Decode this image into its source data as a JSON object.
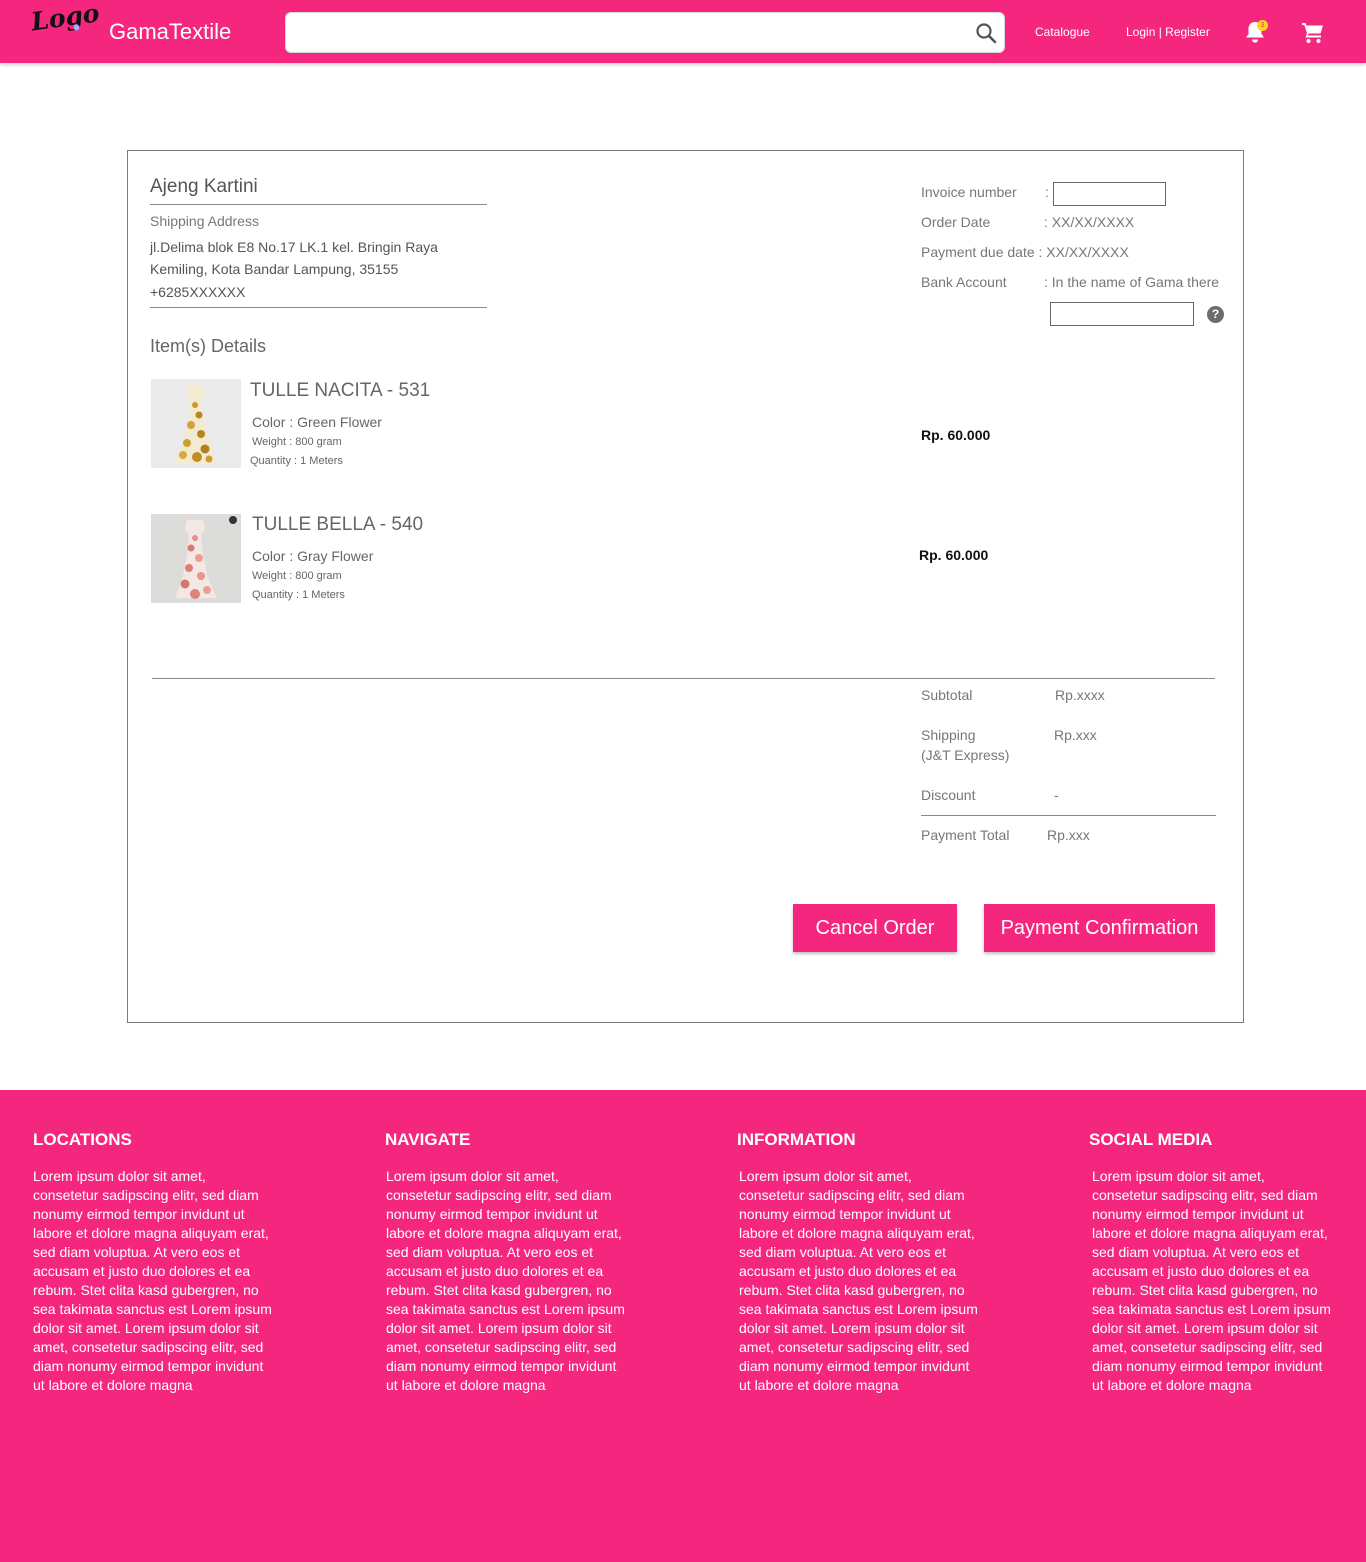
{
  "header": {
    "logo_text": "Logo",
    "brand": "GamaTextile",
    "search": {
      "value": "",
      "placeholder": ""
    },
    "catalogue": "Catalogue",
    "login_register": "Login | Register",
    "notification_count": "3"
  },
  "customer": {
    "name": "Ajeng Kartini",
    "shipping_label": "Shipping Address",
    "address_line1": "jl.Delima blok E8 No.17 LK.1 kel. Bringin Raya",
    "address_line2": "Kemiling, Kota Bandar Lampung, 35155",
    "phone": "+6285XXXXXX"
  },
  "invoice": {
    "invoice_number_label": "Invoice number",
    "invoice_number_value": "",
    "order_date_label": "Order Date",
    "order_date_value": ": XX/XX/XXXX",
    "payment_due_label": "Payment due date : XX/XX/XXXX",
    "bank_account_label": "Bank Account",
    "bank_account_value": ": In the name of Gama there",
    "bank_account_input": "",
    "colon": ":",
    "help": "?"
  },
  "items_title": "Item(s) Details",
  "items": [
    {
      "name": "TULLE NACITA - 531",
      "color": "Color : Green Flower",
      "weight": "Weight : 800 gram",
      "quantity": "Quantity : 1 Meters",
      "price": "Rp. 60.000"
    },
    {
      "name": "TULLE BELLA - 540",
      "color": "Color : Gray Flower",
      "weight": "Weight : 800 gram",
      "quantity": "Quantity : 1 Meters",
      "price": "Rp. 60.000"
    }
  ],
  "summary": {
    "subtotal_label": "Subtotal",
    "subtotal_value": "Rp.xxxx",
    "shipping_label": "Shipping",
    "shipping_carrier": "(J&T Express)",
    "shipping_value": "Rp.xxx",
    "discount_label": "Discount",
    "discount_value": "-",
    "total_label": "Payment Total",
    "total_value": "Rp.xxx"
  },
  "buttons": {
    "cancel": "Cancel Order",
    "confirm": "Payment Confirmation"
  },
  "footer": {
    "columns": [
      {
        "title": "LOCATIONS",
        "text": "Lorem ipsum dolor sit amet, consetetur sadipscing elitr, sed diam nonumy eirmod tempor invidunt ut labore et dolore magna aliquyam erat, sed diam voluptua. At vero eos et accusam et justo duo dolores et ea rebum. Stet clita kasd gubergren, no sea takimata sanctus est Lorem ipsum dolor sit amet. Lorem ipsum dolor sit amet, consetetur sadipscing elitr, sed diam nonumy eirmod tempor invidunt ut labore et dolore magna"
      },
      {
        "title": "NAVIGATE",
        "text": "Lorem ipsum dolor sit amet, consetetur sadipscing elitr, sed diam nonumy eirmod tempor invidunt ut labore et dolore magna aliquyam erat, sed diam voluptua. At vero eos et accusam et justo duo dolores et ea rebum. Stet clita kasd gubergren, no sea takimata sanctus est Lorem ipsum dolor sit amet. Lorem ipsum dolor sit amet, consetetur sadipscing elitr, sed diam nonumy eirmod tempor invidunt ut labore et dolore magna"
      },
      {
        "title": "INFORMATION",
        "text": "Lorem ipsum dolor sit amet, consetetur sadipscing elitr, sed diam nonumy eirmod tempor invidunt ut labore et dolore magna aliquyam erat, sed diam voluptua. At vero eos et accusam et justo duo dolores et ea rebum. Stet clita kasd gubergren, no sea takimata sanctus est Lorem ipsum dolor sit amet. Lorem ipsum dolor sit amet, consetetur sadipscing elitr, sed diam nonumy eirmod tempor invidunt ut labore et dolore magna"
      },
      {
        "title": "SOCIAL MEDIA",
        "text": "Lorem ipsum dolor sit amet, consetetur sadipscing elitr, sed diam nonumy eirmod tempor invidunt ut labore et dolore magna aliquyam erat, sed diam voluptua. At vero eos et accusam et justo duo dolores et ea rebum. Stet clita kasd gubergren, no sea takimata sanctus est Lorem ipsum dolor sit amet. Lorem ipsum dolor sit amet, consetetur sadipscing elitr, sed diam nonumy eirmod tempor invidunt ut labore et dolore magna"
      }
    ]
  },
  "colors": {
    "brand_pink": "#f5267e",
    "badge_yellow": "#ffd41c"
  },
  "icons": [
    "logo-icon",
    "search-icon",
    "bell-icon",
    "cart-icon",
    "help-icon"
  ]
}
